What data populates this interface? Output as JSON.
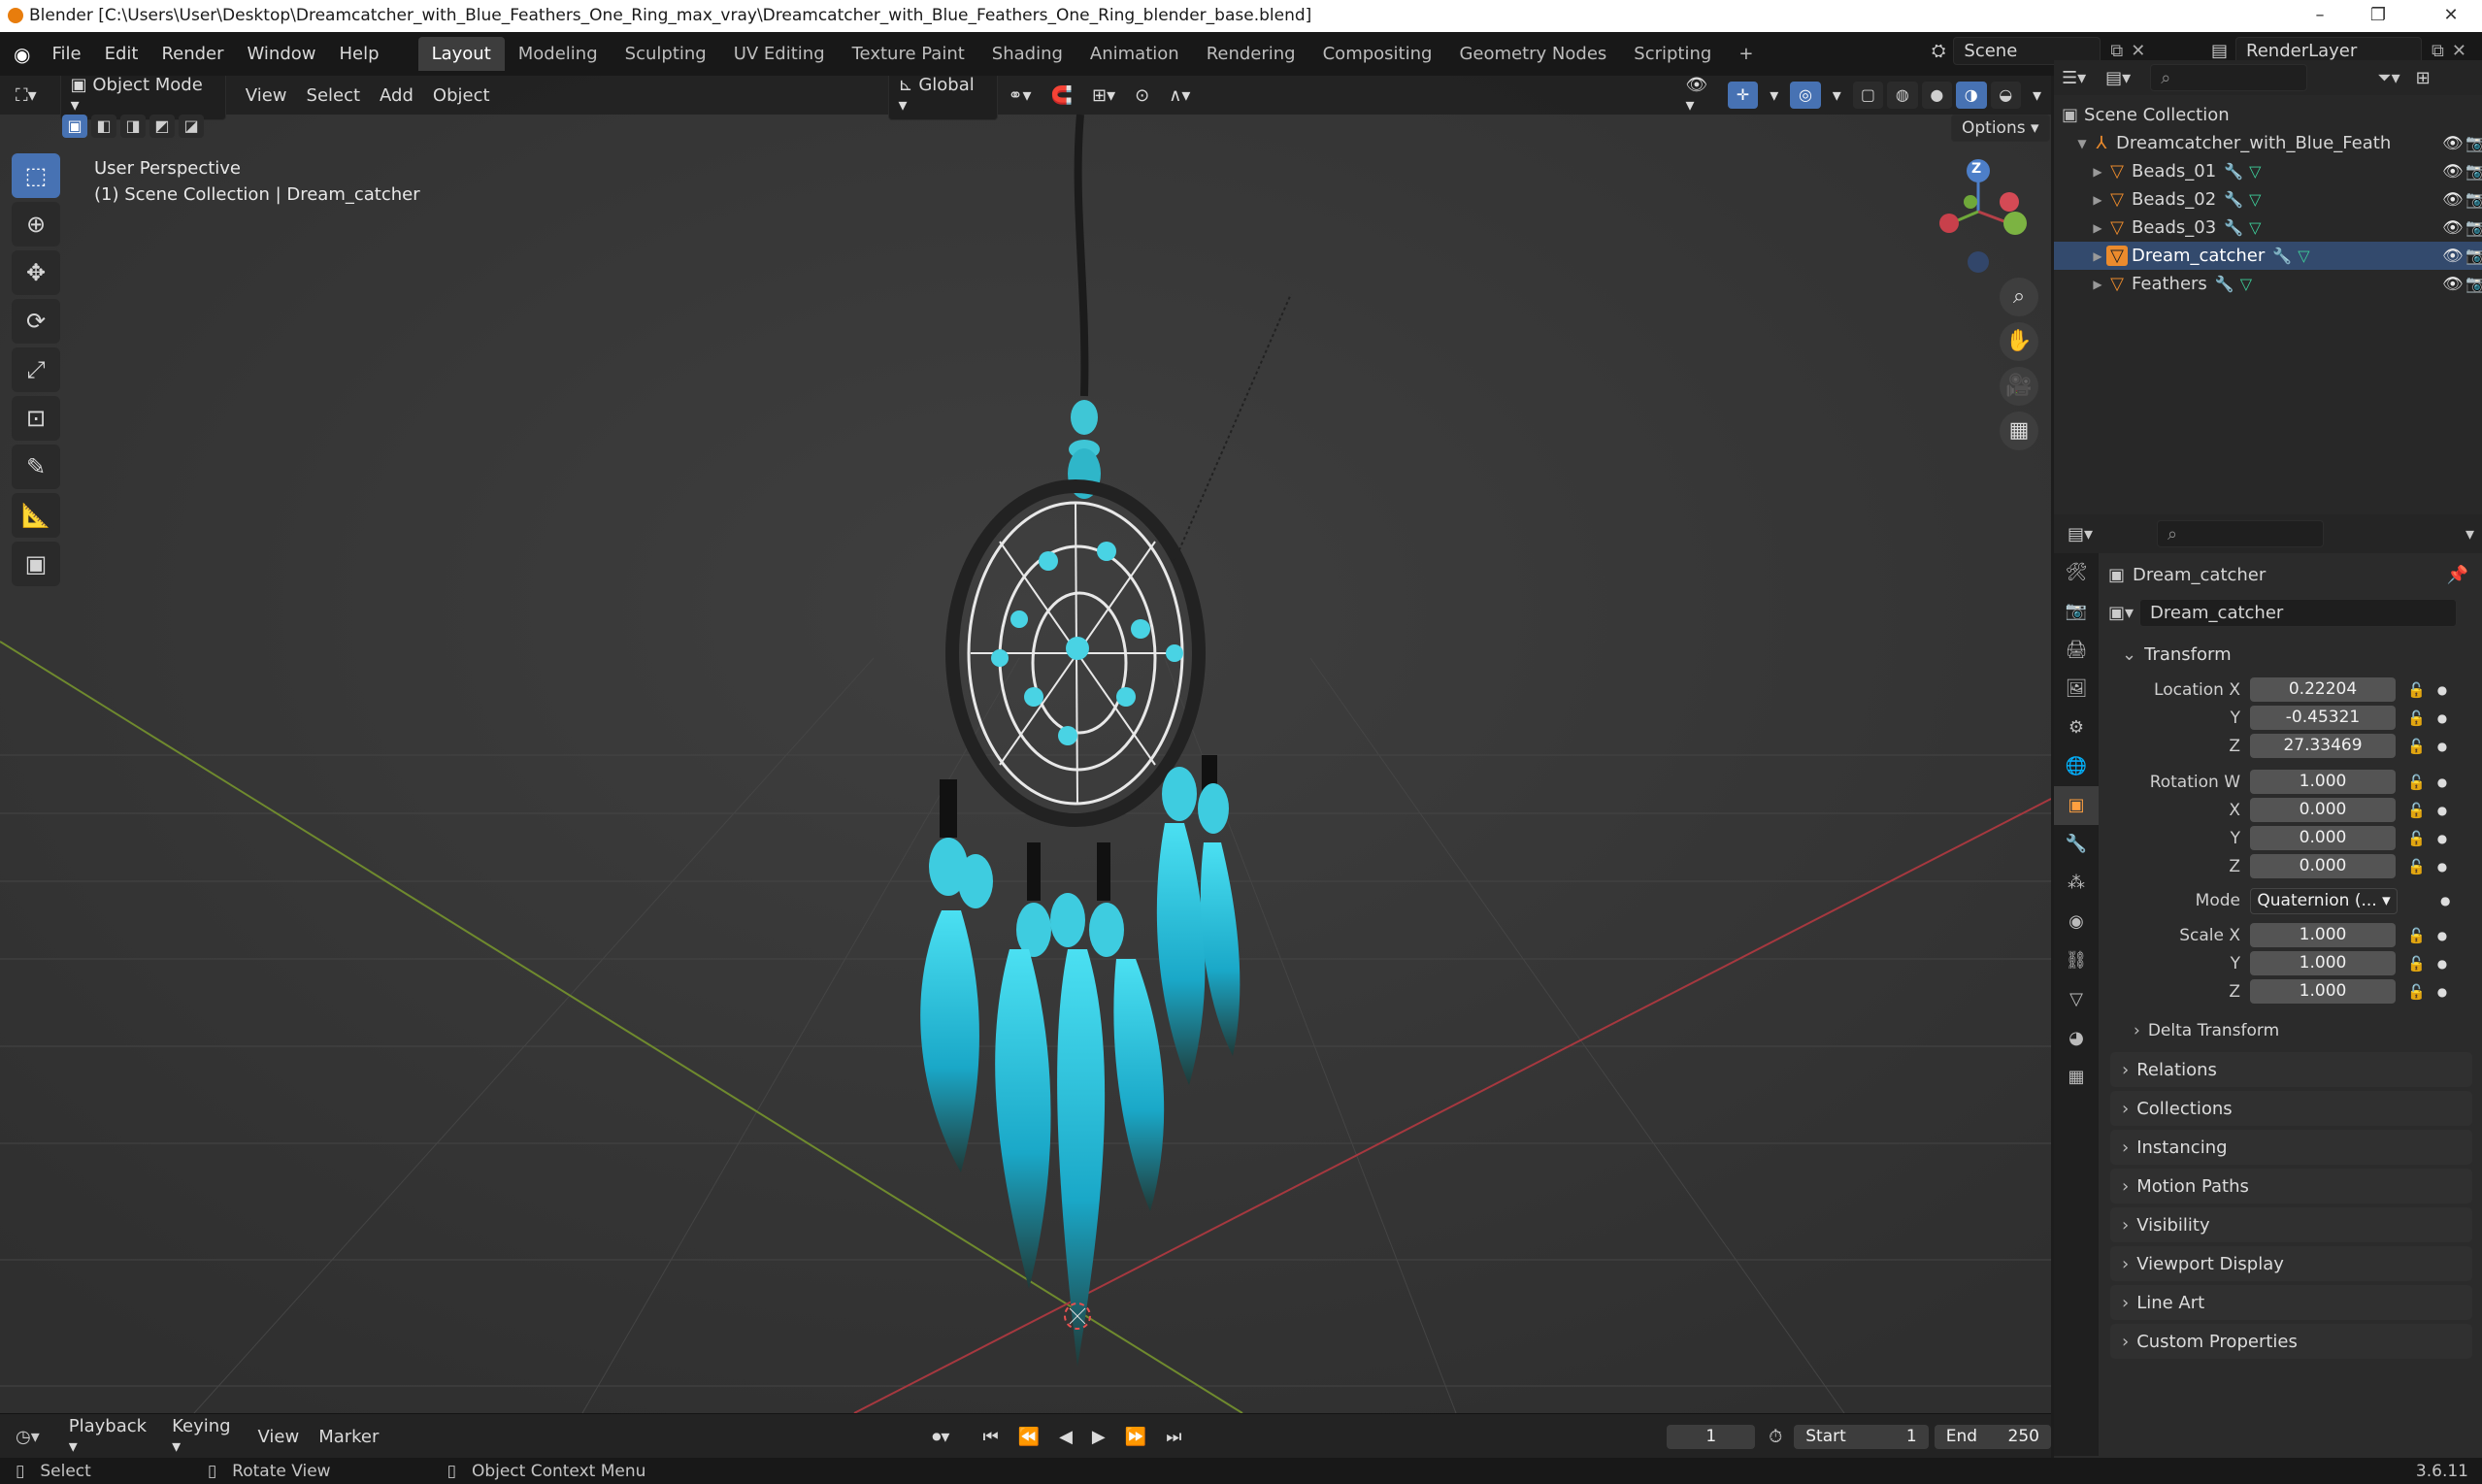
{
  "window": {
    "title": "Blender [C:\\Users\\User\\Desktop\\Dreamcatcher_with_Blue_Feathers_One_Ring_max_vray\\Dreamcatcher_with_Blue_Feathers_One_Ring_blender_base.blend]"
  },
  "menubar": {
    "items": [
      "File",
      "Edit",
      "Render",
      "Window",
      "Help"
    ],
    "workspaces": [
      "Layout",
      "Modeling",
      "Sculpting",
      "UV Editing",
      "Texture Paint",
      "Shading",
      "Animation",
      "Rendering",
      "Compositing",
      "Geometry Nodes",
      "Scripting"
    ],
    "add_tab": "+",
    "scene": "Scene",
    "render_layer": "RenderLayer"
  },
  "viewport": {
    "mode": "Object Mode",
    "menus": [
      "View",
      "Select",
      "Add",
      "Object"
    ],
    "orientation": "Global",
    "options_label": "Options",
    "overlay_title": "User Perspective",
    "overlay_subtitle": "(1) Scene Collection | Dream_catcher",
    "gizmo_axis": "Z"
  },
  "outliner": {
    "root": "Scene Collection",
    "collection": "Dreamcatcher_with_Blue_Feath",
    "objects": [
      "Beads_01",
      "Beads_02",
      "Beads_03",
      "Dream_catcher",
      "Feathers"
    ]
  },
  "properties": {
    "header_name": "Dream_catcher",
    "object_name": "Dream_catcher",
    "transform_label": "Transform",
    "location": {
      "label_x": "Location X",
      "label_y": "Y",
      "label_z": "Z",
      "x": "0.22204",
      "y": "-0.45321",
      "z": "27.33469"
    },
    "rotation": {
      "label_w": "Rotation W",
      "label_x": "X",
      "label_y": "Y",
      "label_z": "Z",
      "w": "1.000",
      "x": "0.000",
      "y": "0.000",
      "z": "0.000"
    },
    "mode": {
      "label": "Mode",
      "value": "Quaternion (..."
    },
    "scale": {
      "label_x": "Scale X",
      "label_y": "Y",
      "label_z": "Z",
      "x": "1.000",
      "y": "1.000",
      "z": "1.000"
    },
    "delta_transform": "Delta Transform",
    "panels": [
      "Relations",
      "Collections",
      "Instancing",
      "Motion Paths",
      "Visibility",
      "Viewport Display",
      "Line Art",
      "Custom Properties"
    ]
  },
  "timeline": {
    "menus": [
      "Playback",
      "Keying",
      "View",
      "Marker"
    ],
    "current_frame": "1",
    "start_label": "Start",
    "start": "1",
    "end_label": "End",
    "end": "250"
  },
  "statusbar": {
    "select": "Select",
    "rotate": "Rotate View",
    "context": "Object Context Menu",
    "version": "3.6.11"
  },
  "colors": {
    "accent": "#4772b3",
    "object_orange": "#ea8a2c",
    "feather_blue": "#2ec7e0"
  }
}
